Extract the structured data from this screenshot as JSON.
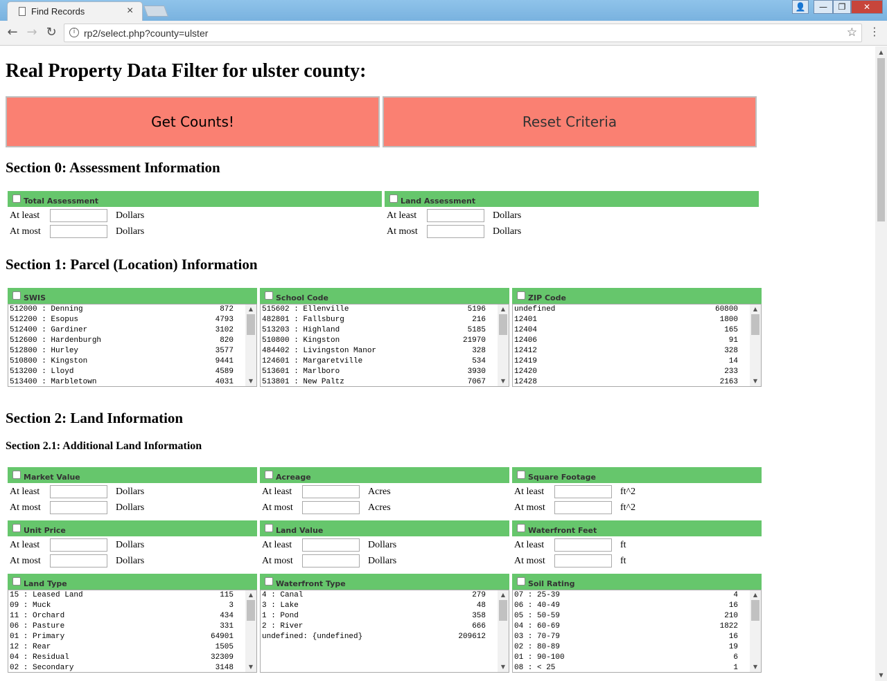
{
  "browser": {
    "tab_title": "Find Records",
    "tab_close": "×",
    "url": "rp2/select.php?county=ulster",
    "back": "←",
    "forward": "→",
    "reload": "↻",
    "star": "☆",
    "menu": "⋮",
    "info": "i",
    "win_user": "👤",
    "win_min": "—",
    "win_max": "❐",
    "win_close": "✕"
  },
  "page": {
    "title": "Real Property Data Filter for ulster county:",
    "get_counts": "Get Counts!",
    "reset": "Reset Criteria",
    "accent_color": "#66c66c",
    "button_color": "#fa8072"
  },
  "labels": {
    "at_least": "At least",
    "at_most": "At most"
  },
  "section0": {
    "title": "Section 0: Assessment Information",
    "boxes": [
      {
        "label": "Total Assessment",
        "unit": "Dollars"
      },
      {
        "label": "Land Assessment",
        "unit": "Dollars"
      }
    ]
  },
  "section1": {
    "title": "Section 1: Parcel (Location) Information",
    "lists": [
      {
        "label": "SWIS",
        "options": [
          {
            "key": "512000 : Denning",
            "count": "872"
          },
          {
            "key": "512200 : Esopus",
            "count": "4793"
          },
          {
            "key": "512400 : Gardiner",
            "count": "3102"
          },
          {
            "key": "512600 : Hardenburgh",
            "count": "820"
          },
          {
            "key": "512800 : Hurley",
            "count": "3577"
          },
          {
            "key": "510800 : Kingston",
            "count": "9441"
          },
          {
            "key": "513200 : Lloyd",
            "count": "4589"
          },
          {
            "key": "513400 : Marbletown",
            "count": "4031"
          }
        ]
      },
      {
        "label": "School Code",
        "options": [
          {
            "key": "515602 : Ellenville",
            "count": "5196"
          },
          {
            "key": "482801 : Fallsburg",
            "count": "216"
          },
          {
            "key": "513203 : Highland",
            "count": "5185"
          },
          {
            "key": "510800 : Kingston",
            "count": "21970"
          },
          {
            "key": "484402 : Livingston Manor",
            "count": "328"
          },
          {
            "key": "124601 : Margaretville",
            "count": "534"
          },
          {
            "key": "513601 : Marlboro",
            "count": "3930"
          },
          {
            "key": "513801 : New Paltz",
            "count": "7067"
          }
        ]
      },
      {
        "label": "ZIP Code",
        "options": [
          {
            "key": "undefined",
            "count": "60800"
          },
          {
            "key": "12401",
            "count": "1800"
          },
          {
            "key": "12404",
            "count": "165"
          },
          {
            "key": "12406",
            "count": "91"
          },
          {
            "key": "12412",
            "count": "328"
          },
          {
            "key": "12419",
            "count": "14"
          },
          {
            "key": "12420",
            "count": "233"
          },
          {
            "key": "12428",
            "count": "2163"
          }
        ]
      }
    ]
  },
  "section2": {
    "title": "Section 2: Land Information",
    "subtitle": "Section 2.1: Additional Land Information",
    "boxes": [
      {
        "label": "Market Value",
        "unit": "Dollars"
      },
      {
        "label": "Acreage",
        "unit": "Acres"
      },
      {
        "label": "Square Footage",
        "unit": "ft^2"
      },
      {
        "label": "Unit Price",
        "unit": "Dollars"
      },
      {
        "label": "Land Value",
        "unit": "Dollars"
      },
      {
        "label": "Waterfront Feet",
        "unit": "ft"
      }
    ],
    "lists": [
      {
        "label": "Land Type",
        "options": [
          {
            "key": "15 : Leased Land",
            "count": "115"
          },
          {
            "key": "09 : Muck",
            "count": "3"
          },
          {
            "key": "11 : Orchard",
            "count": "434"
          },
          {
            "key": "06 : Pasture",
            "count": "331"
          },
          {
            "key": "01 : Primary",
            "count": "64901"
          },
          {
            "key": "12 : Rear",
            "count": "1505"
          },
          {
            "key": "04 : Residual",
            "count": "32309"
          },
          {
            "key": "02 : Secondary",
            "count": "3148"
          }
        ]
      },
      {
        "label": "Waterfront Type",
        "options": [
          {
            "key": "4 : Canal",
            "count": "279"
          },
          {
            "key": "3 : Lake",
            "count": "48"
          },
          {
            "key": "1 : Pond",
            "count": "358"
          },
          {
            "key": "2 : River",
            "count": "666"
          },
          {
            "key": "undefined: {undefined}",
            "count": "209612"
          }
        ]
      },
      {
        "label": "Soil Rating",
        "options": [
          {
            "key": "07 : 25-39",
            "count": "4"
          },
          {
            "key": "06 : 40-49",
            "count": "16"
          },
          {
            "key": "05 : 50-59",
            "count": "210"
          },
          {
            "key": "04 : 60-69",
            "count": "1822"
          },
          {
            "key": "03 : 70-79",
            "count": "16"
          },
          {
            "key": "02 : 80-89",
            "count": "19"
          },
          {
            "key": "01 : 90-100",
            "count": "6"
          },
          {
            "key": "08 : < 25",
            "count": "1"
          }
        ]
      }
    ]
  },
  "scroll": {
    "up": "▲",
    "down": "▼"
  }
}
